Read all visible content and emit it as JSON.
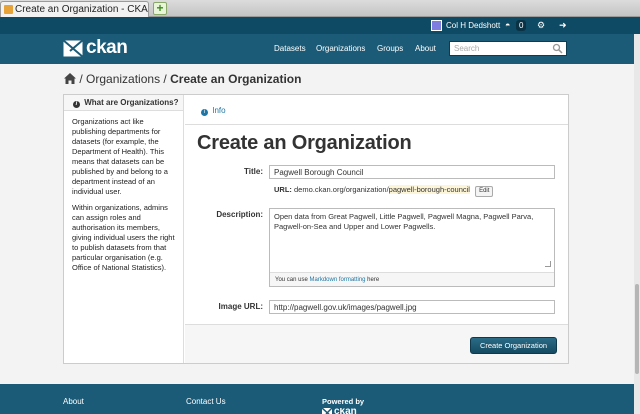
{
  "browser": {
    "tab_title": "Create an Organization - CKAN",
    "new_tab_symbol": "+"
  },
  "account": {
    "user_name": "Col H Dedshott",
    "activity_count": "0",
    "dashboard_icon": "dashboard-icon",
    "settings_icon": "gear-icon",
    "logout_icon": "logout-icon"
  },
  "masthead": {
    "logo_text": "ckan",
    "nav": [
      "Datasets",
      "Organizations",
      "Groups",
      "About"
    ],
    "search": {
      "placeholder": "Search",
      "value": ""
    }
  },
  "breadcrumb": {
    "home_icon": "home-icon",
    "separator": "/",
    "items": [
      "Organizations",
      "Create an Organization"
    ]
  },
  "sidebar": {
    "heading": "What are Organizations?",
    "paragraphs": [
      "Organizations act like publishing departments for datasets (for example, the Department of Health). This means that datasets can be published by and belong to a department instead of an individual user.",
      "Within organizations, admins can assign roles and authorisation its members, giving individual users the right to publish datasets from that particular organisation (e.g. Office of National Statistics)."
    ]
  },
  "content": {
    "info_tab": "Info",
    "heading": "Create an Organization",
    "title_label": "Title:",
    "title_value": "Pagwell Borough Council",
    "url_label": "URL:",
    "url_prefix": "demo.ckan.org/organization/",
    "url_slug": "pagwell-borough-council",
    "edit_label": "Edit",
    "description_label": "Description:",
    "description_value": "Open data from Great Pagwell, Little Pagwell, Pagwell Magna, Pagwell Parva, Pagwell-on-Sea and Upper and Lower Pagwells.",
    "markdown_hint_pre": "You can use ",
    "markdown_link": "Markdown formatting",
    "markdown_hint_post": " here",
    "image_url_label": "Image URL:",
    "image_url_value": "http://pagwell.gov.uk/images/pagwell.jpg",
    "submit_label": "Create Organization"
  },
  "footer": {
    "col1": [
      "About"
    ],
    "col2": [
      "Contact Us"
    ],
    "powered_by": "Powered by",
    "logo_text": "ckan"
  },
  "colors": {
    "masthead": "#1b5b77",
    "account_bar": "#0e4a63",
    "link": "#1f76a4",
    "button": "#154b62"
  }
}
